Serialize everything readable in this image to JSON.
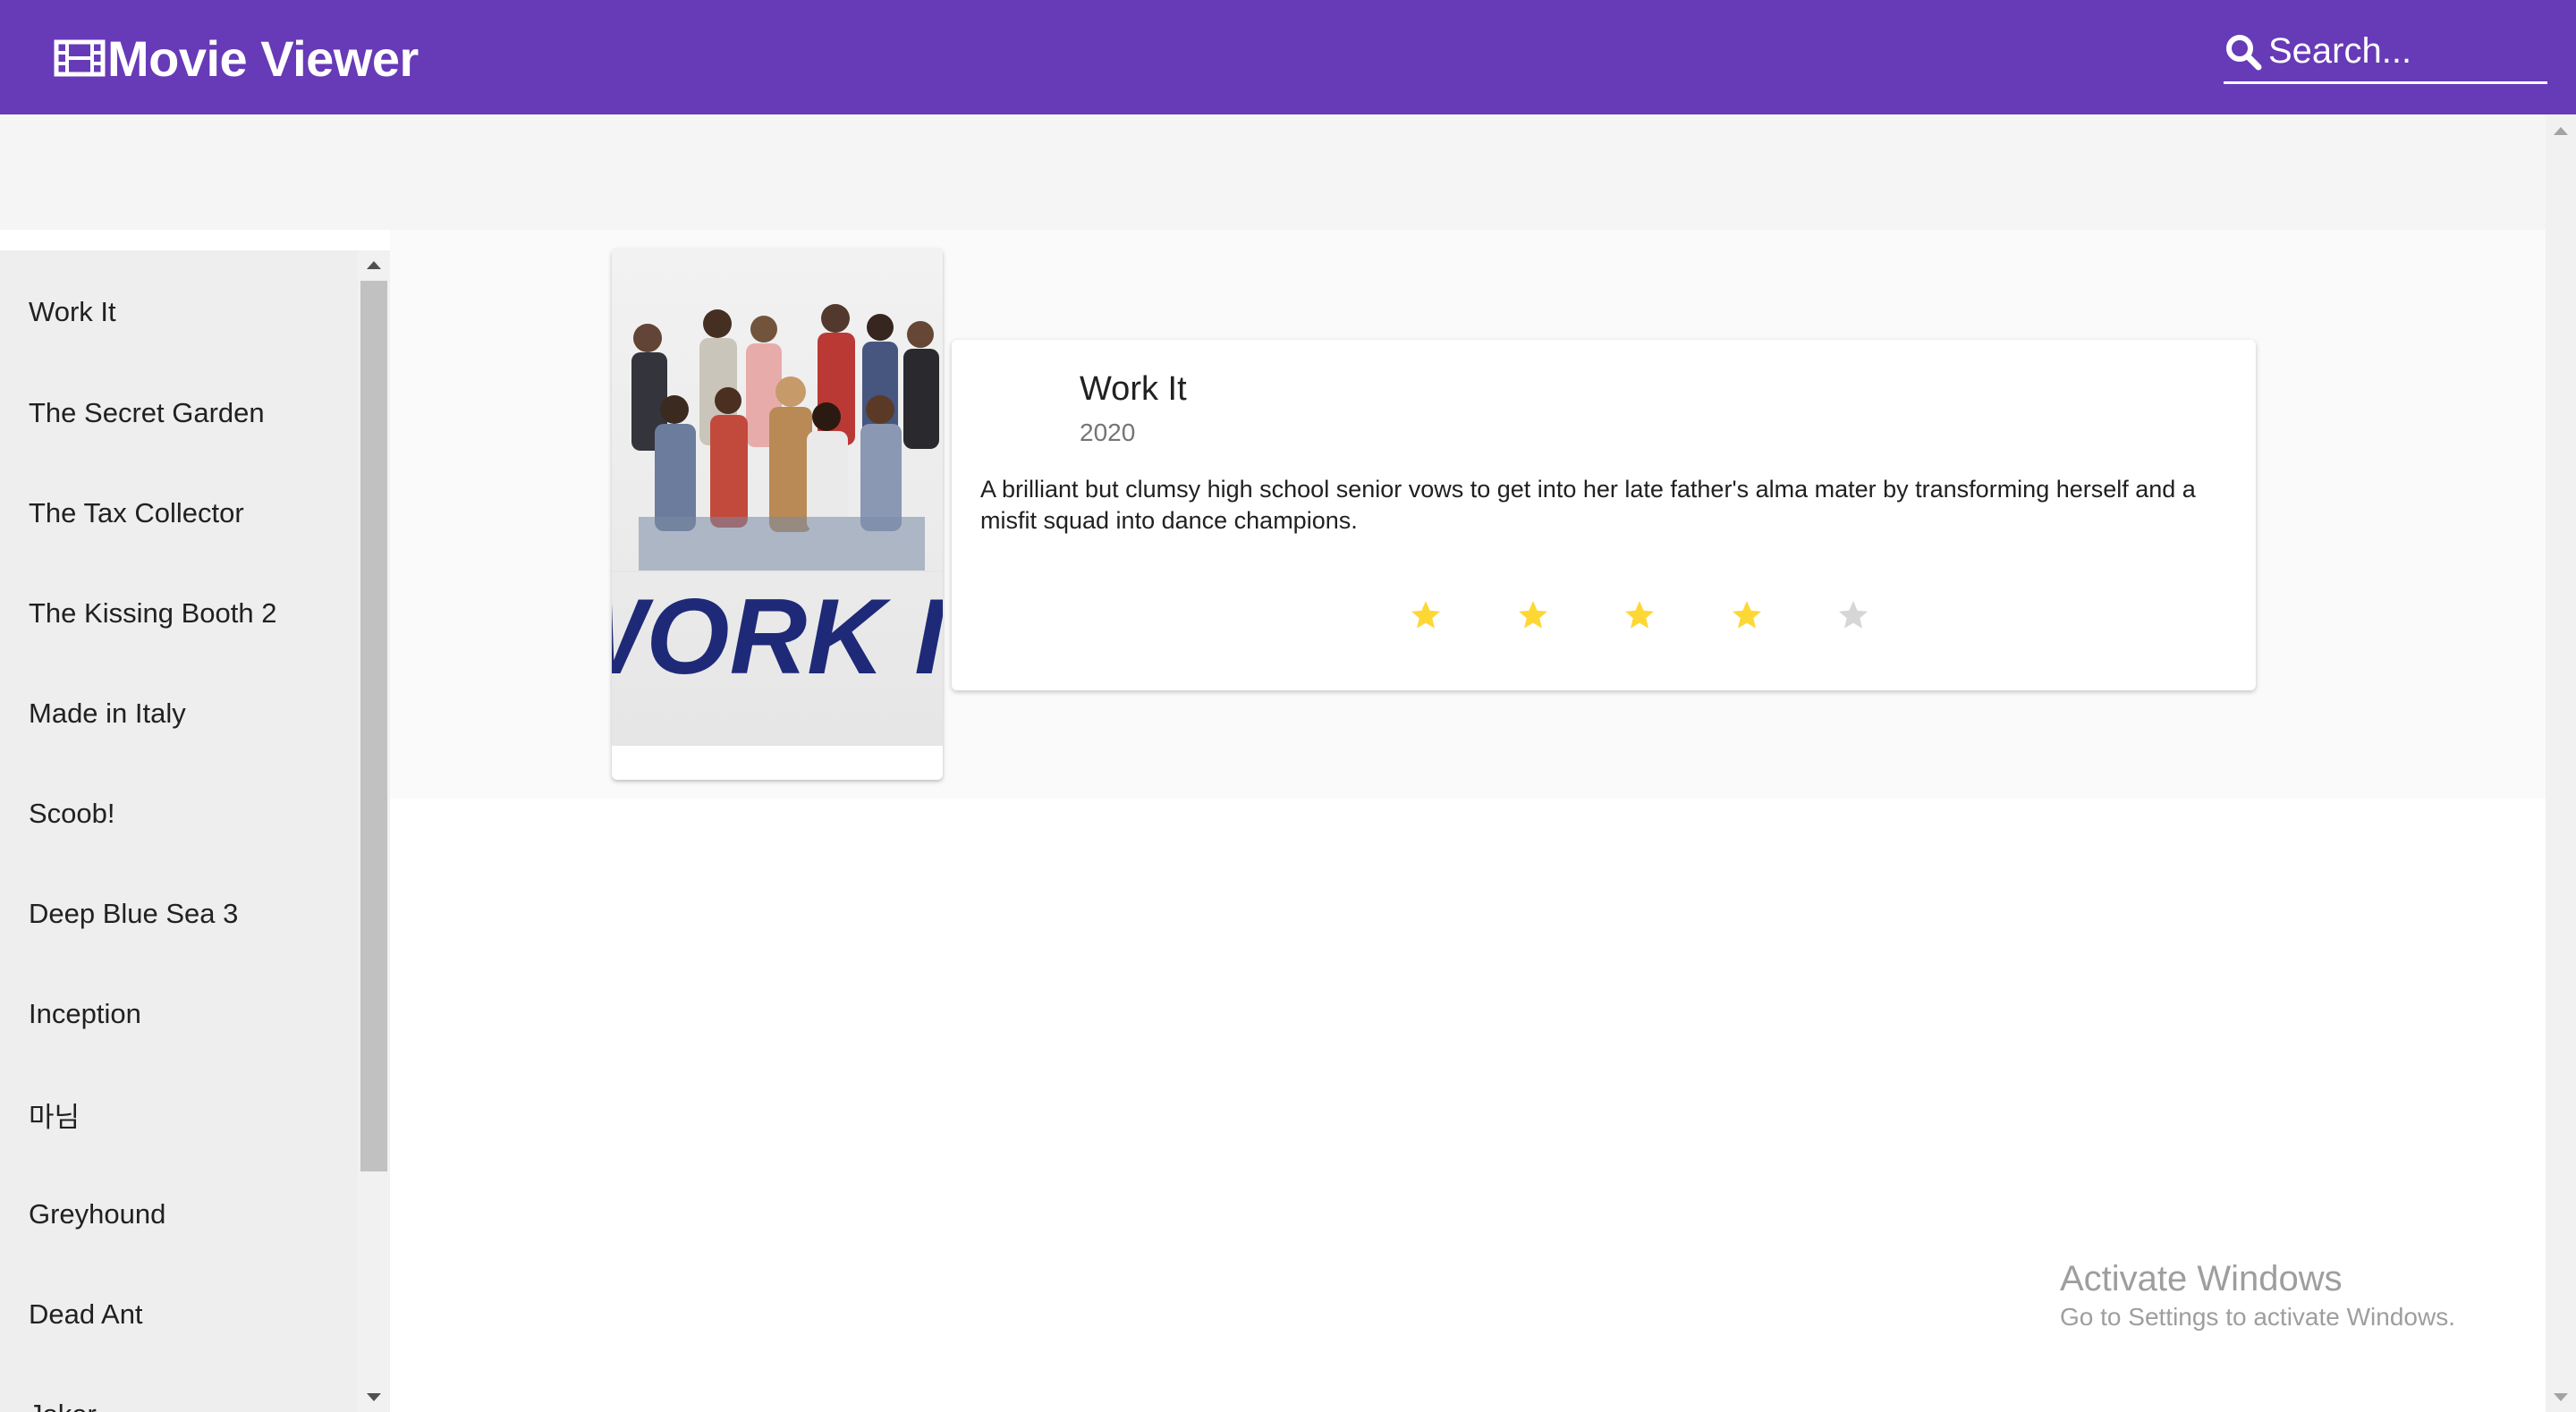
{
  "header": {
    "title": "Movie Viewer",
    "brand_icon": "film-icon",
    "search_icon": "search-icon",
    "search_placeholder": "Search...",
    "background_color": "#673ab7"
  },
  "sidebar": {
    "items": [
      {
        "label": "Work It"
      },
      {
        "label": "The Secret Garden"
      },
      {
        "label": "The Tax Collector"
      },
      {
        "label": "The Kissing Booth 2"
      },
      {
        "label": "Made in Italy"
      },
      {
        "label": "Scoob!"
      },
      {
        "label": "Deep Blue Sea 3"
      },
      {
        "label": "Inception"
      },
      {
        "label": "마님"
      },
      {
        "label": "Greyhound"
      },
      {
        "label": "Dead Ant"
      },
      {
        "label": "Joker"
      }
    ]
  },
  "movie": {
    "title": "Work It",
    "year": "2020",
    "description": "A brilliant but clumsy high school senior vows to get into her late father's alma mater by transforming herself and a misfit squad into dance champions.",
    "poster_title_text": "WORK IT",
    "rating": 4,
    "rating_max": 5,
    "star_color_filled": "#fdd835",
    "star_color_empty": "#d6d6d6"
  },
  "watermark": {
    "title": "Activate Windows",
    "subtitle": "Go to Settings to activate Windows."
  }
}
